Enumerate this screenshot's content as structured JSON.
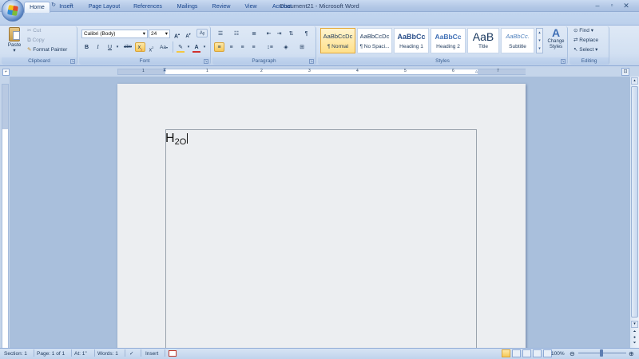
{
  "window": {
    "title": "Document21 - Microsoft Word",
    "controls": [
      "minimize",
      "maximize",
      "close"
    ]
  },
  "quick_access": [
    "save-icon",
    "undo-icon",
    "redo-icon",
    "customize-icon"
  ],
  "tabs": [
    "Home",
    "Insert",
    "Page Layout",
    "References",
    "Mailings",
    "Review",
    "View",
    "Acrobat"
  ],
  "active_tab": "Home",
  "clipboard": {
    "paste": "Paste",
    "cut": "Cut",
    "copy": "Copy",
    "format_painter": "Format Painter",
    "label": "Clipboard"
  },
  "font": {
    "name": "Calibri (Body)",
    "size": "24",
    "grow": "A",
    "shrink": "A",
    "bold": "B",
    "italic": "I",
    "underline": "U",
    "strike": "abe",
    "subscript": "x",
    "superscript": "x",
    "change_case": "Aa",
    "font_color": "A",
    "label": "Font"
  },
  "paragraph": {
    "label": "Paragraph"
  },
  "styles": {
    "items": [
      {
        "preview": "AaBbCcDc",
        "name": "¶ Normal"
      },
      {
        "preview": "AaBbCcDc",
        "name": "¶ No Spaci..."
      },
      {
        "preview": "AaBbCc",
        "name": "Heading 1"
      },
      {
        "preview": "AaBbCc",
        "name": "Heading 2"
      },
      {
        "preview": "AaB",
        "name": "Title"
      },
      {
        "preview": "AaBbCc.",
        "name": "Subtitle"
      }
    ],
    "change_styles": "Change Styles",
    "label": "Styles"
  },
  "editing": {
    "find": "Find",
    "replace": "Replace",
    "select": "Select",
    "label": "Editing"
  },
  "ruler_numbers": [
    "1",
    "1",
    "2",
    "3",
    "4",
    "5",
    "6",
    "7"
  ],
  "document": {
    "text_main": "H",
    "text_sub": "2",
    "text_after": "O"
  },
  "status": {
    "section": "Section: 1",
    "page": "Page: 1 of 1",
    "at": "At: 1\"",
    "words": "Words: 1",
    "mode": "Insert",
    "zoom": "100%"
  },
  "colors": {
    "ribbon_bg": "#d2e0f2",
    "highlight": "#f4c842",
    "font_color_bar": "#d0312d"
  }
}
